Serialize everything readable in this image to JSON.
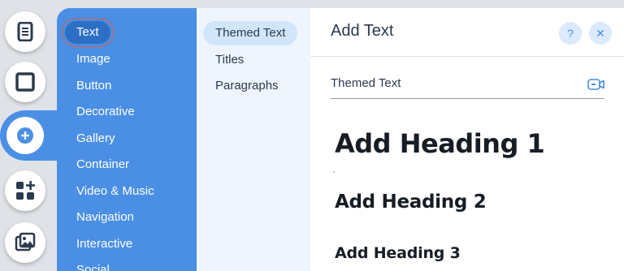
{
  "categories": [
    {
      "label": "Text",
      "selected": true
    },
    {
      "label": "Image"
    },
    {
      "label": "Button"
    },
    {
      "label": "Decorative"
    },
    {
      "label": "Gallery"
    },
    {
      "label": "Container"
    },
    {
      "label": "Video & Music"
    },
    {
      "label": "Navigation"
    },
    {
      "label": "Interactive"
    },
    {
      "label": "Social"
    }
  ],
  "subcategories": [
    {
      "label": "Themed Text",
      "selected": true
    },
    {
      "label": "Titles"
    },
    {
      "label": "Paragraphs"
    }
  ],
  "panel": {
    "title": "Add Text",
    "help_label": "?",
    "close_label": "✕",
    "section_label": "Themed Text",
    "headings": [
      "Add Heading 1",
      "Add Heading 2",
      "Add Heading 3"
    ]
  },
  "rail": {
    "icons": [
      "pages-icon",
      "background-icon",
      "add-icon",
      "add-apps-icon",
      "media-icon"
    ],
    "active": "add-icon"
  },
  "colors": {
    "accent": "#4a8fe4",
    "selected_category": "#2c6fc4",
    "highlight_box": "#e05a48",
    "sub_panel": "#eef5fe",
    "text_dark": "#2b3a4e"
  }
}
